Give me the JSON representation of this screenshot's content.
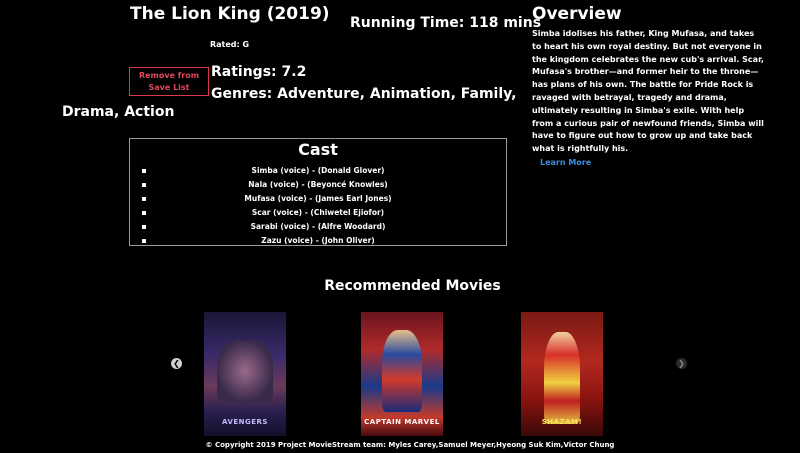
{
  "movie": {
    "title": "The Lion King (2019)",
    "running_time": "Running Time: 118 mins",
    "rated": "Rated: G",
    "ratings": "Ratings: 7.2",
    "genres_line1": "Genres: Adventure, Animation, Family,",
    "genres_line2": "Drama, Action"
  },
  "actions": {
    "remove_label": "Remove from Save List"
  },
  "overview": {
    "title": "Overview",
    "text": "Simba idolises his father, King Mufasa, and takes to heart his own royal destiny. But not everyone in the kingdom celebrates the new cub's arrival. Scar, Mufasa's brother—and former heir to the throne—has plans of his own. The battle for Pride Rock is ravaged with betrayal, tragedy and drama, ultimately resulting in Simba's exile. With help from a curious pair of newfound friends, Simba will have to figure out how to grow up and take back what is rightfully his.",
    "learn_more": "Learn More"
  },
  "cast": {
    "title": "Cast",
    "items": [
      "Simba (voice) - (Donald Glover)",
      "Nala (voice) - (Beyoncé Knowles)",
      "Mufasa (voice) - (James Earl Jones)",
      "Scar (voice) - (Chiwetel Ejiofor)",
      "Sarabi (voice) - (Alfre Woodard)",
      "Zazu (voice) - (John Oliver)"
    ]
  },
  "recommended": {
    "title": "Recommended Movies",
    "posters": [
      {
        "caption": "AVENGERS",
        "icon": "avengers-poster"
      },
      {
        "caption": "CAPTAIN MARVEL",
        "icon": "captain-marvel-poster"
      },
      {
        "caption": "SHAZAM!",
        "icon": "shazam-poster"
      }
    ],
    "prev_icon": "chevron-left-icon",
    "next_icon": "chevron-right-icon"
  },
  "footer": {
    "text": "© Copyright 2019 Project MovieStream team: Myles Carey,Samuel Meyer,Hyeong Suk Kim,Victor Chung"
  },
  "colors": {
    "background": "#000000",
    "text": "#ffffff",
    "remove_accent": "#e0475a",
    "link": "#3b8de0"
  }
}
